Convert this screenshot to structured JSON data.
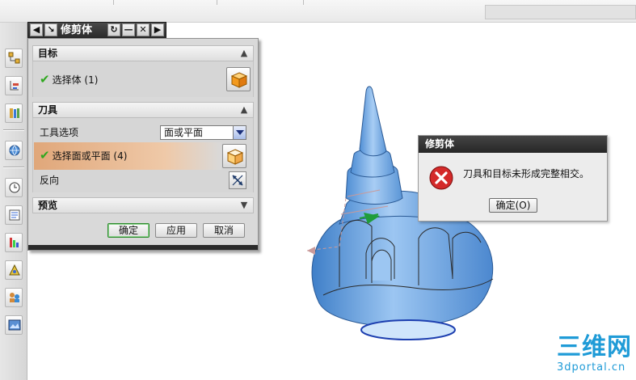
{
  "dialog": {
    "title": "修剪体",
    "target": {
      "header": "目标",
      "select_label": "选择体",
      "select_count": "(1)"
    },
    "tool": {
      "header": "刀具",
      "option_label": "工具选项",
      "option_value": "面或平面",
      "select_label": "选择面或平面",
      "select_count": "(4)",
      "reverse_label": "反向"
    },
    "preview": {
      "header": "预览"
    },
    "buttons": {
      "ok": "确定",
      "apply": "应用",
      "cancel": "取消"
    }
  },
  "error_dialog": {
    "title": "修剪体",
    "message": "刀具和目标未形成完整相交。",
    "ok": "确定(O)"
  },
  "colors": {
    "model_blue": "#6ea6e0",
    "title_bar": "#2b2b2b",
    "highlight": "#e0a77a",
    "check": "#2fa81f",
    "error_red": "#d42a2a"
  },
  "icons": {
    "target": "cube-icon",
    "tool": "cube-icon",
    "reverse": "reverse-direction-icon",
    "error": "error-icon"
  }
}
